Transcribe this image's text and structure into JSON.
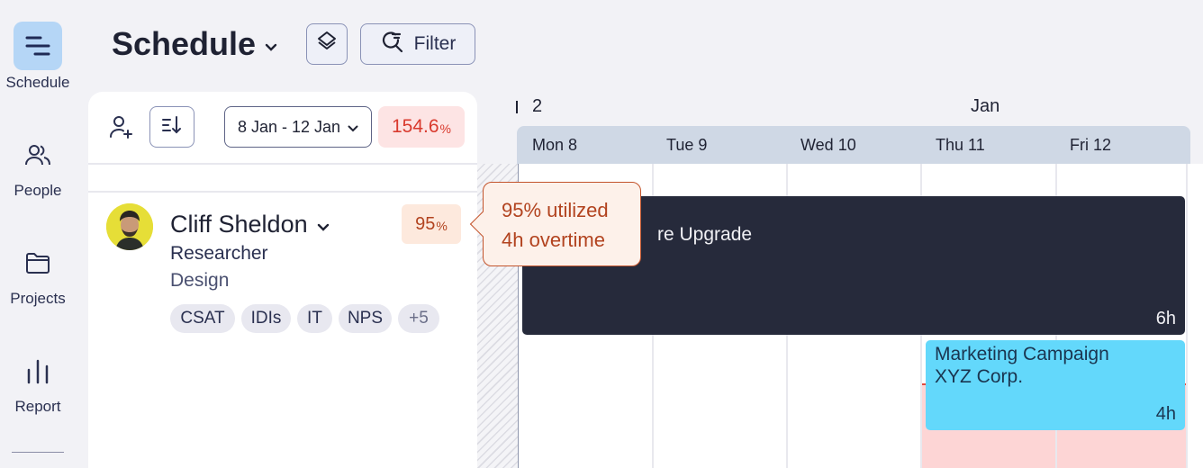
{
  "nav": {
    "items": [
      {
        "label": "Schedule",
        "icon": "schedule-icon",
        "active": true
      },
      {
        "label": "People",
        "icon": "people-icon"
      },
      {
        "label": "Projects",
        "icon": "folder-icon"
      },
      {
        "label": "Report",
        "icon": "bar-chart-icon"
      }
    ]
  },
  "header": {
    "title": "Schedule",
    "filter_label": "Filter"
  },
  "panel": {
    "date_range": "8 Jan - 12 Jan",
    "total_utilization": "154.6",
    "percent_sign": "%"
  },
  "person": {
    "name": "Cliff Sheldon",
    "role": "Researcher",
    "department": "Design",
    "utilization": "95",
    "tags": [
      "CSAT",
      "IDIs",
      "IT",
      "NPS"
    ],
    "more_tags": "+5"
  },
  "tooltip": {
    "line1_num": "95%",
    "line1_text": "utilized",
    "line2_num": "4h",
    "line2_text": "overtime"
  },
  "calendar": {
    "week_number": "2",
    "month": "Jan",
    "days": [
      {
        "name": "Mon",
        "num": "8"
      },
      {
        "name": "Tue",
        "num": "9"
      },
      {
        "name": "Wed",
        "num": "10"
      },
      {
        "name": "Thu",
        "num": "11"
      },
      {
        "name": "Fri",
        "num": "12"
      }
    ]
  },
  "tasks": [
    {
      "title_line1": "re Upgrade",
      "title_line2": "",
      "hours": "6h",
      "color": "#262a3b"
    },
    {
      "title_line1": "Marketing Campaign",
      "title_line2": "XYZ Corp.",
      "hours": "4h",
      "color": "#63d8fb"
    }
  ],
  "colors": {
    "accent": "#b5d6f6",
    "overtime": "#fdd5d5",
    "warning_text": "#b2431f",
    "danger_text": "#d93a2e"
  }
}
